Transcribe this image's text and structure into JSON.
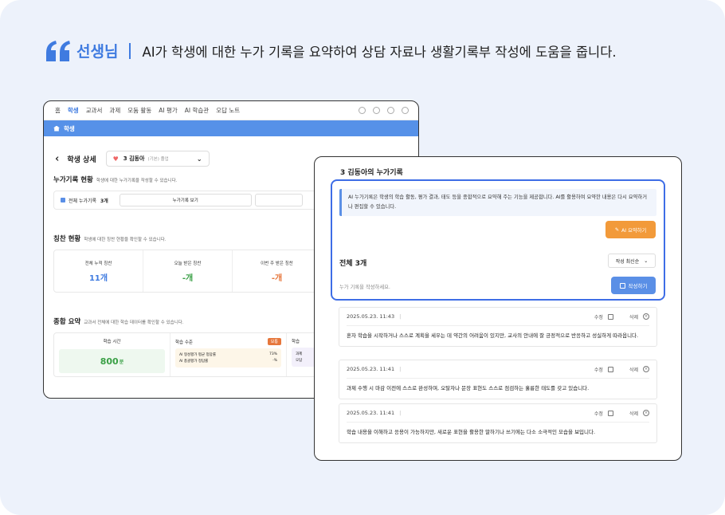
{
  "headline": {
    "role": "선생님",
    "text": "AI가 학생에 대한 누가 기록을 요약하여 상담 자료나 생활기록부 작성에 도움을 줍니다."
  },
  "back_window": {
    "nav": [
      "홈",
      "학생",
      "교과서",
      "과제",
      "모둠 활동",
      "AI 평가",
      "AI 학습관",
      "오답 노트"
    ],
    "breadcrumb": "학생",
    "detail_title": "학생 상세",
    "student": {
      "name": "3 김동아",
      "tag": "(기본) 졸업"
    },
    "accumulation": {
      "title": "누가기록 현황",
      "subtitle": "학생에 대한 누가기록을 작성할 수 있습니다.",
      "total_label": "전체 누가기록",
      "total_value": "3개",
      "view_button": "누가기록 보기"
    },
    "praise": {
      "title": "칭찬 현황",
      "subtitle": "학생에 대한 칭찬 현황을 확인할 수 있습니다.",
      "items": [
        {
          "label": "전체 누적 칭찬",
          "value": "11개",
          "color": "#3f7be0"
        },
        {
          "label": "오늘 받은 칭찬",
          "value": "-개",
          "color": "#3aa046"
        },
        {
          "label": "이번 주 받은 칭찬",
          "value": "-개",
          "color": "#e6773c"
        }
      ]
    },
    "summary": {
      "title": "종합 요약",
      "subtitle": "교과서 전체에 대한 학습 데이터를 확인할 수 있습니다.",
      "time_label": "학습 시간",
      "time_value": "800",
      "time_unit": "분",
      "level_label": "학습 수준",
      "level_badge": "보통",
      "level_rows": [
        {
          "label": "AI 형성평가 평균 정답률",
          "value": "73%"
        },
        {
          "label": "AI 총괄평가 정답률",
          "value": "-%"
        }
      ],
      "third_label": "학습",
      "third_rows": [
        "과제",
        "오답"
      ]
    }
  },
  "front_window": {
    "title": "3 김동아의 누가기록",
    "info_text": "AI 누가기록은 학생의 학습 활동, 평가 결과, 태도 등을 종합적으로 요약해 주는 기능을 제공합니다. AI를 활용하여 요약한 내용은 다시 요약하거나 편집할 수 있습니다.",
    "ai_button": "AI 요약하기",
    "total": "전체 3개",
    "sort": "작성 최신순",
    "placeholder": "누가 기록을 작성하세요.",
    "write_button": "작성하기",
    "edit_label": "수정",
    "delete_label": "삭제",
    "records": [
      {
        "date": "2025.05.23. 11:43",
        "text": "혼자 학습을 시작하거나 스스로 계획을 세우는 데 약간의 어려움이 있지만, 교사의 안내에 잘 긍정적으로 반응하고 성실하게 따라옵니다."
      },
      {
        "date": "2025.05.23. 11:41",
        "text": "과제 수행 시 마감 이전에 스스로 완성하며, 오탈자나 문장 표현도 스스로 점검하는 훌륭한 태도를 갖고 있습니다."
      },
      {
        "date": "2025.05.23. 11:41",
        "text": "학습 내용을 이해하고 응용이 가능하지만, 새로운 표현을 활용한 말하기나 쓰기에는 다소 소극적인 모습을 보입니다."
      }
    ]
  }
}
